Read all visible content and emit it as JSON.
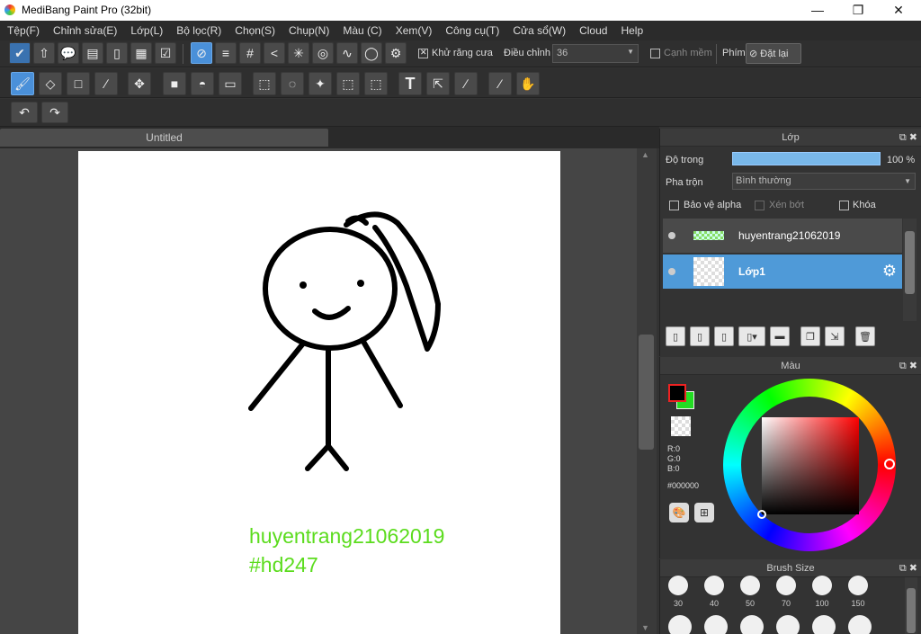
{
  "window": {
    "title": "MediBang Paint Pro (32bit)",
    "minimize": "—",
    "maximize": "❐",
    "close": "✕"
  },
  "menu": [
    "Tệp(F)",
    "Chỉnh sửa(E)",
    "Lớp(L)",
    "Bộ lọc(R)",
    "Chọn(S)",
    "Chụp(N)",
    "Màu (C)",
    "Xem(V)",
    "Công cụ(T)",
    "Cửa sổ(W)",
    "Cloud",
    "Help"
  ],
  "toolbar1": {
    "antialias_label": "Khử răng cưa",
    "adjust_label": "Điều chỉnh",
    "adjust_value": "36",
    "soft_edge_label": "Cạnh mềm",
    "key_label": "Phím",
    "reset_label": "Đặt lại"
  },
  "document": {
    "tab_title": "Untitled",
    "text_line1": "huyentrang21062019",
    "text_line2": "#hd247"
  },
  "layer_panel": {
    "title": "Lớp",
    "opacity_label": "Độ trong",
    "opacity_value": "100 %",
    "blend_label": "Pha trộn",
    "blend_value": "Bình thường",
    "protect_alpha": "Bảo vệ alpha",
    "clipping": "Xén bớt",
    "lock": "Khóa",
    "layers": [
      {
        "name": "huyentrang21062019"
      },
      {
        "name": "Lớp1"
      }
    ]
  },
  "color_panel": {
    "title": "Màu",
    "r": "R:0",
    "g": "G:0",
    "b": "B:0",
    "hex": "#000000",
    "primary": "#000000",
    "secondary": "#22dd22"
  },
  "brush_panel": {
    "title": "Brush Size",
    "sizes": [
      "30",
      "40",
      "50",
      "70",
      "100",
      "150"
    ]
  }
}
